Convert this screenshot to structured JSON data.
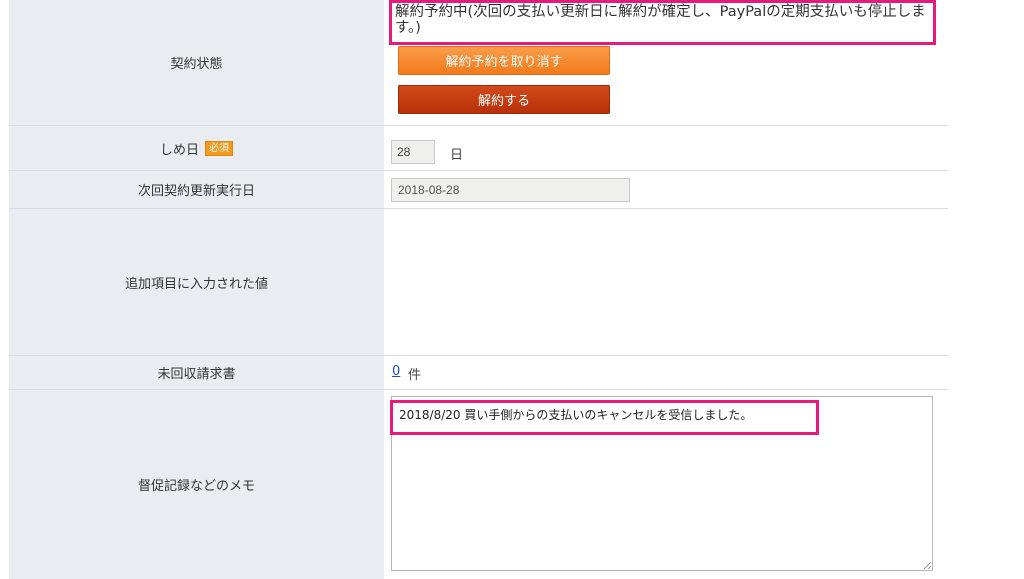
{
  "contract_status": {
    "label": "契約状態",
    "status_text": "解約予約中(次回の支払い更新日に解約が確定し、PayPalの定期支払いも停止します。)",
    "cancel_reservation_button": "解約予約を取り消す",
    "terminate_button": "解約する"
  },
  "closing_day": {
    "label": "しめ日",
    "required_badge": "必須",
    "value": "28",
    "unit": "日"
  },
  "next_renewal": {
    "label": "次回契約更新実行日",
    "value": "2018-08-28"
  },
  "additional_items": {
    "label": "追加項目に入力された値"
  },
  "unpaid_invoices": {
    "label": "未回収請求書",
    "count": "0",
    "unit": "件"
  },
  "memo": {
    "label": "督促記録などのメモ",
    "text": "2018/8/20 買い手側からの支払いのキャンセルを受信しました。"
  },
  "colors": {
    "highlight": "#e6197d",
    "label_bg": "#e9edf1",
    "cancel_button": "#f47a1b",
    "terminate_button": "#b83008"
  }
}
